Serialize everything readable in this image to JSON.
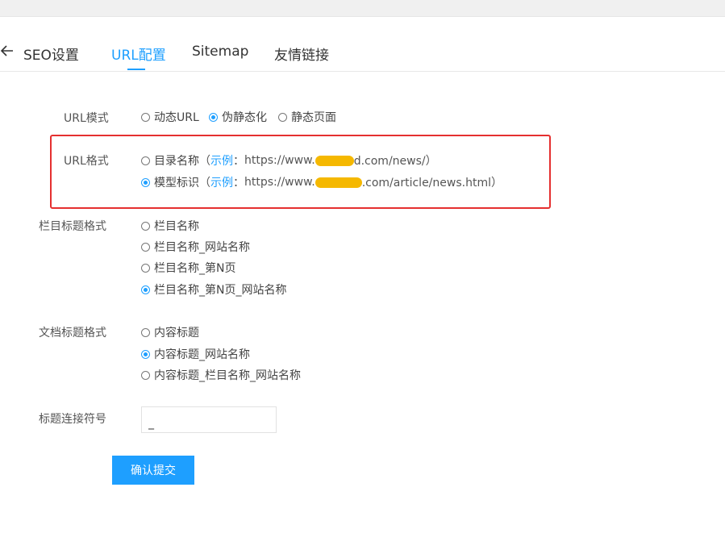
{
  "tabs": {
    "items": [
      {
        "label": "SEO设置"
      },
      {
        "label": "URL配置"
      },
      {
        "label": "Sitemap"
      },
      {
        "label": "友情链接"
      }
    ],
    "active": "URL配置"
  },
  "form": {
    "url_mode": {
      "label": "URL模式",
      "options": [
        {
          "label": "动态URL",
          "checked": false
        },
        {
          "label": "伪静态化",
          "checked": true
        },
        {
          "label": "静态页面",
          "checked": false
        }
      ]
    },
    "url_format": {
      "label": "URL格式",
      "options": [
        {
          "label": "目录名称",
          "example_prefix": "（",
          "example_label": "示例",
          "example_sep": "：",
          "url_before": "https://www.",
          "url_after": "d.com/news/）",
          "checked": false
        },
        {
          "label": "模型标识",
          "example_prefix": "（",
          "example_label": "示例",
          "example_sep": "：",
          "url_before": "https://www.",
          "url_after": ".com/article/news.html）",
          "checked": true
        }
      ]
    },
    "column_title_format": {
      "label": "栏目标题格式",
      "options": [
        {
          "label": "栏目名称",
          "checked": false
        },
        {
          "label": "栏目名称_网站名称",
          "checked": false
        },
        {
          "label": "栏目名称_第N页",
          "checked": false
        },
        {
          "label": "栏目名称_第N页_网站名称",
          "checked": true
        }
      ]
    },
    "doc_title_format": {
      "label": "文档标题格式",
      "options": [
        {
          "label": "内容标题",
          "checked": false
        },
        {
          "label": "内容标题_网站名称",
          "checked": true
        },
        {
          "label": "内容标题_栏目名称_网站名称",
          "checked": false
        }
      ]
    },
    "title_separator": {
      "label": "标题连接符号",
      "value": "_"
    },
    "submit_label": "确认提交"
  },
  "colors": {
    "accent": "#1e9fff",
    "highlight_border": "#e53030",
    "redaction": "#f5b800"
  }
}
